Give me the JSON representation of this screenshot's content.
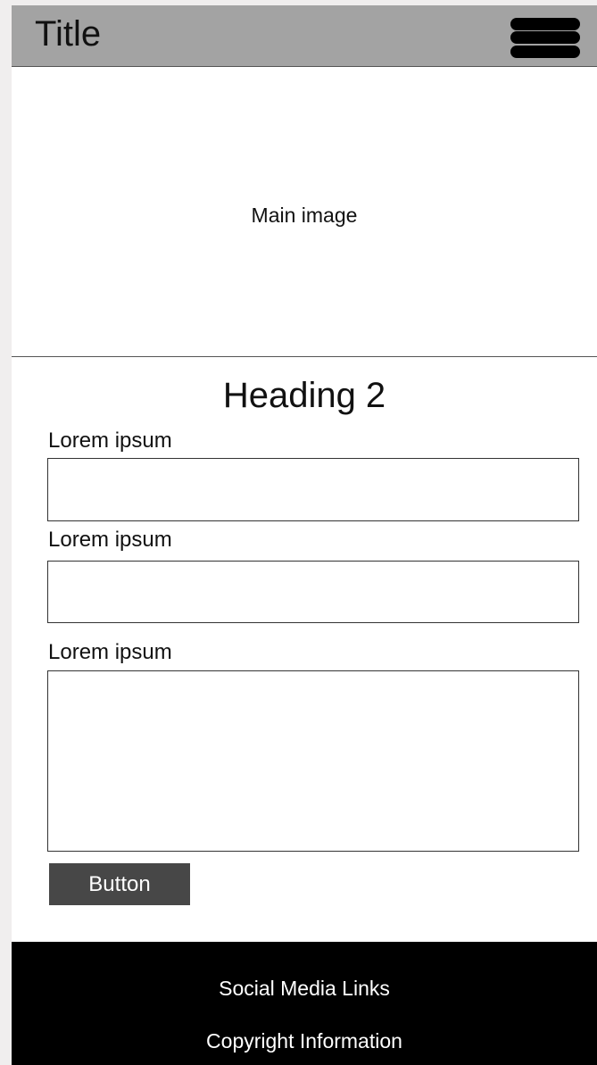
{
  "header": {
    "title": "Title",
    "menu_icon": "hamburger-menu-icon",
    "background_color": "#a3a3a3"
  },
  "hero": {
    "label": "Main image"
  },
  "form": {
    "heading": "Heading 2",
    "fields": [
      {
        "label": "Lorem ipsum",
        "value": "",
        "placeholder": ""
      },
      {
        "label": "Lorem ipsum",
        "value": "",
        "placeholder": ""
      },
      {
        "label": "Lorem ipsum",
        "value": "",
        "placeholder": ""
      }
    ],
    "button_label": "Button",
    "button_color": "#474747"
  },
  "footer": {
    "social_label": "Social Media Links",
    "copyright_label": "Copyright Information",
    "background_color": "#000000"
  }
}
